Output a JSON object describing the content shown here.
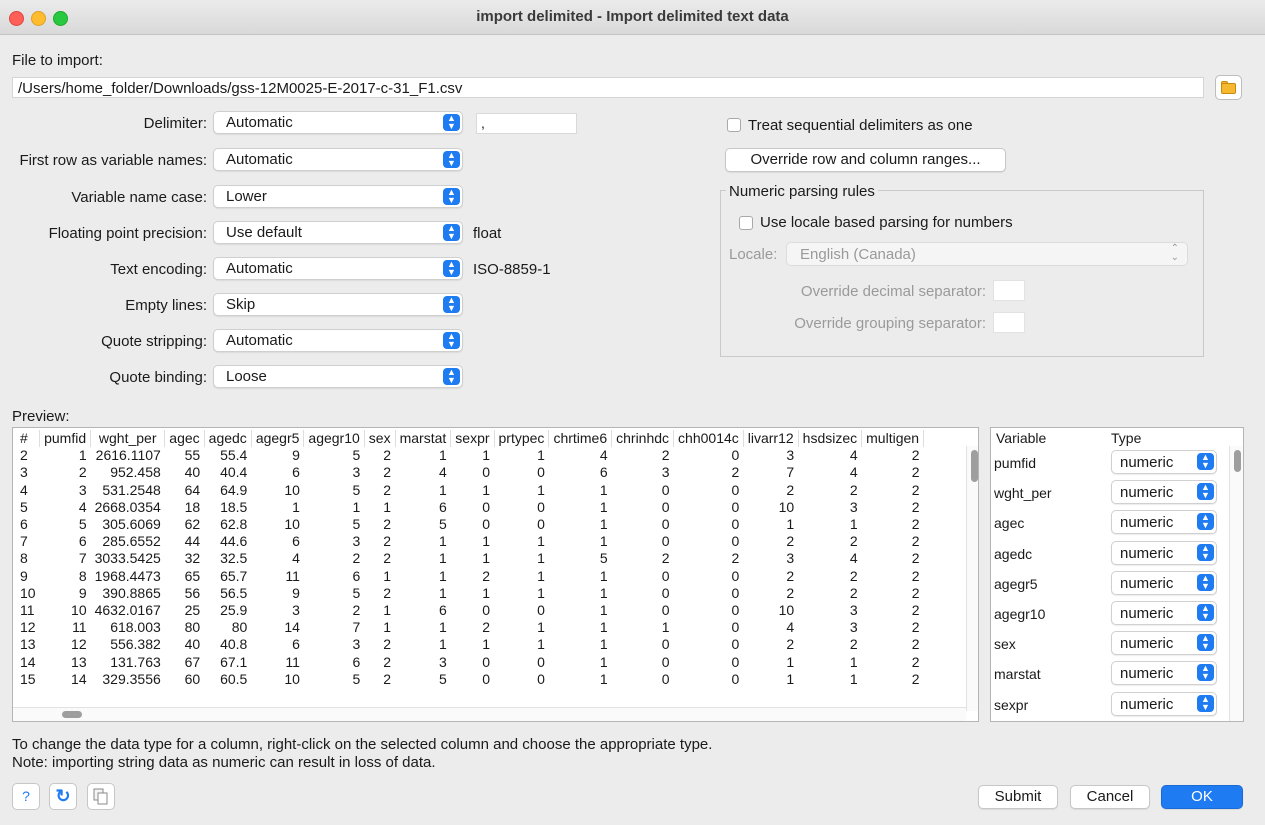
{
  "window": {
    "title": "import delimited - Import delimited text data"
  },
  "file": {
    "label": "File to import:",
    "path": "/Users/home_folder/Downloads/gss-12M0025-E-2017-c-31_F1.csv"
  },
  "options": {
    "delimiter": {
      "label": "Delimiter:",
      "value": "Automatic",
      "custom": ","
    },
    "first_row": {
      "label": "First row as variable names:",
      "value": "Automatic"
    },
    "name_case": {
      "label": "Variable name case:",
      "value": "Lower"
    },
    "float_precision": {
      "label": "Floating point precision:",
      "value": "Use default",
      "note": "float"
    },
    "encoding": {
      "label": "Text encoding:",
      "value": "Automatic",
      "note": "ISO-8859-1"
    },
    "empty_lines": {
      "label": "Empty lines:",
      "value": "Skip"
    },
    "quote_stripping": {
      "label": "Quote stripping:",
      "value": "Automatic"
    },
    "quote_binding": {
      "label": "Quote binding:",
      "value": "Loose"
    }
  },
  "right_options": {
    "sequential_delims": "Treat sequential delimiters as one",
    "override_ranges": "Override row and column ranges...",
    "numeric_group": {
      "title": "Numeric parsing rules",
      "locale_parsing": "Use locale based parsing for numbers",
      "locale_label": "Locale:",
      "locale_value": "English (Canada)",
      "decimal_sep": "Override decimal separator:",
      "grouping_sep": "Override grouping separator:"
    }
  },
  "preview": {
    "label": "Preview:",
    "columns": [
      "#",
      "pumfid",
      "wght_per",
      "agec",
      "agedc",
      "agegr5",
      "agegr10",
      "sex",
      "marstat",
      "sexpr",
      "prtypec",
      "chrtime6",
      "chrinhdc",
      "chh0014c",
      "livarr12",
      "hsdsizec",
      "multigen"
    ],
    "rows": [
      [
        "2",
        "1",
        "2616.1107",
        "55",
        "55.4",
        "9",
        "5",
        "2",
        "1",
        "1",
        "1",
        "4",
        "2",
        "0",
        "3",
        "4",
        "2"
      ],
      [
        "3",
        "2",
        "952.458",
        "40",
        "40.4",
        "6",
        "3",
        "2",
        "4",
        "0",
        "0",
        "6",
        "3",
        "2",
        "7",
        "4",
        "2"
      ],
      [
        "4",
        "3",
        "531.2548",
        "64",
        "64.9",
        "10",
        "5",
        "2",
        "1",
        "1",
        "1",
        "1",
        "0",
        "0",
        "2",
        "2",
        "2"
      ],
      [
        "5",
        "4",
        "2668.0354",
        "18",
        "18.5",
        "1",
        "1",
        "1",
        "6",
        "0",
        "0",
        "1",
        "0",
        "0",
        "10",
        "3",
        "2"
      ],
      [
        "6",
        "5",
        "305.6069",
        "62",
        "62.8",
        "10",
        "5",
        "2",
        "5",
        "0",
        "0",
        "1",
        "0",
        "0",
        "1",
        "1",
        "2"
      ],
      [
        "7",
        "6",
        "285.6552",
        "44",
        "44.6",
        "6",
        "3",
        "2",
        "1",
        "1",
        "1",
        "1",
        "0",
        "0",
        "2",
        "2",
        "2"
      ],
      [
        "8",
        "7",
        "3033.5425",
        "32",
        "32.5",
        "4",
        "2",
        "2",
        "1",
        "1",
        "1",
        "5",
        "2",
        "2",
        "3",
        "4",
        "2"
      ],
      [
        "9",
        "8",
        "1968.4473",
        "65",
        "65.7",
        "11",
        "6",
        "1",
        "1",
        "2",
        "1",
        "1",
        "0",
        "0",
        "2",
        "2",
        "2"
      ],
      [
        "10",
        "9",
        "390.8865",
        "56",
        "56.5",
        "9",
        "5",
        "2",
        "1",
        "1",
        "1",
        "1",
        "0",
        "0",
        "2",
        "2",
        "2"
      ],
      [
        "11",
        "10",
        "4632.0167",
        "25",
        "25.9",
        "3",
        "2",
        "1",
        "6",
        "0",
        "0",
        "1",
        "0",
        "0",
        "10",
        "3",
        "2"
      ],
      [
        "12",
        "11",
        "618.003",
        "80",
        "80",
        "14",
        "7",
        "1",
        "1",
        "2",
        "1",
        "1",
        "1",
        "0",
        "4",
        "3",
        "2"
      ],
      [
        "13",
        "12",
        "556.382",
        "40",
        "40.8",
        "6",
        "3",
        "2",
        "1",
        "1",
        "1",
        "1",
        "0",
        "0",
        "2",
        "2",
        "2"
      ],
      [
        "14",
        "13",
        "131.763",
        "67",
        "67.1",
        "11",
        "6",
        "2",
        "3",
        "0",
        "0",
        "1",
        "0",
        "0",
        "1",
        "1",
        "2"
      ],
      [
        "15",
        "14",
        "329.3556",
        "60",
        "60.5",
        "10",
        "5",
        "2",
        "5",
        "0",
        "0",
        "1",
        "0",
        "0",
        "1",
        "1",
        "2"
      ]
    ]
  },
  "variables": {
    "header_variable": "Variable",
    "header_type": "Type",
    "items": [
      {
        "name": "pumfid",
        "type": "numeric"
      },
      {
        "name": "wght_per",
        "type": "numeric"
      },
      {
        "name": "agec",
        "type": "numeric"
      },
      {
        "name": "agedc",
        "type": "numeric"
      },
      {
        "name": "agegr5",
        "type": "numeric"
      },
      {
        "name": "agegr10",
        "type": "numeric"
      },
      {
        "name": "sex",
        "type": "numeric"
      },
      {
        "name": "marstat",
        "type": "numeric"
      },
      {
        "name": "sexpr",
        "type": "numeric"
      }
    ]
  },
  "notes": {
    "line1": "To change the data type for a column, right-click on the selected column and choose the appropriate type.",
    "line2": "Note: importing string data as numeric can result in loss of data."
  },
  "footer": {
    "help_glyph": "?",
    "reset_glyph": "↻",
    "submit": "Submit",
    "cancel": "Cancel",
    "ok": "OK"
  },
  "colors": {
    "accent": "#1f7bf2",
    "folder": "#f5b82e"
  }
}
